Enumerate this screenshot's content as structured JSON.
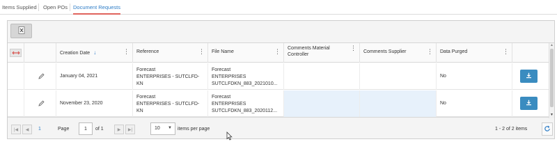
{
  "tabs": [
    {
      "label": "Items Supplied",
      "active": false
    },
    {
      "label": "Open POs",
      "active": false
    },
    {
      "label": "Document Requests",
      "active": true
    }
  ],
  "toolbar": {
    "export_icon": "excel-export-icon"
  },
  "grid": {
    "columns": [
      {
        "label": ""
      },
      {
        "label": ""
      },
      {
        "label": "Creation Date",
        "sorted": "ascending"
      },
      {
        "label": "Reference"
      },
      {
        "label": "File Name"
      },
      {
        "label": "Comments Material Controller"
      },
      {
        "label": "Comments Supplier"
      },
      {
        "label": "Data Purged"
      },
      {
        "label": ""
      }
    ],
    "rows": [
      {
        "creation_date": "January 04, 2021",
        "reference": [
          "Forecast",
          "ENTERPRISES - SUTCLFD-",
          "KN"
        ],
        "file_name": [
          "Forecast",
          "ENTERPRISES",
          "SUTCLFDKN_883_2021010..."
        ],
        "comments_material_controller": "",
        "comments_supplier": "",
        "data_purged": "No"
      },
      {
        "creation_date": "November 23, 2020",
        "reference": [
          "Forecast",
          "ENTERPRISES - SUTCLFD-",
          "KN"
        ],
        "file_name": [
          "Forecast",
          "ENTERPRISES",
          "SUTCLFDKN_883_2020112..."
        ],
        "comments_material_controller": "",
        "comments_supplier": "",
        "data_purged": "No"
      }
    ]
  },
  "pager": {
    "current_page_link": "1",
    "page_label": "Page",
    "page_value": "1",
    "of_label": "of 1",
    "page_size": "10",
    "items_per_page_label": "items per page",
    "summary": "1 - 2 of 2 items"
  },
  "colors": {
    "accent": "#2e7dc7",
    "active_tab_underline": "#e0635c",
    "download_button": "#3a8cc0"
  }
}
